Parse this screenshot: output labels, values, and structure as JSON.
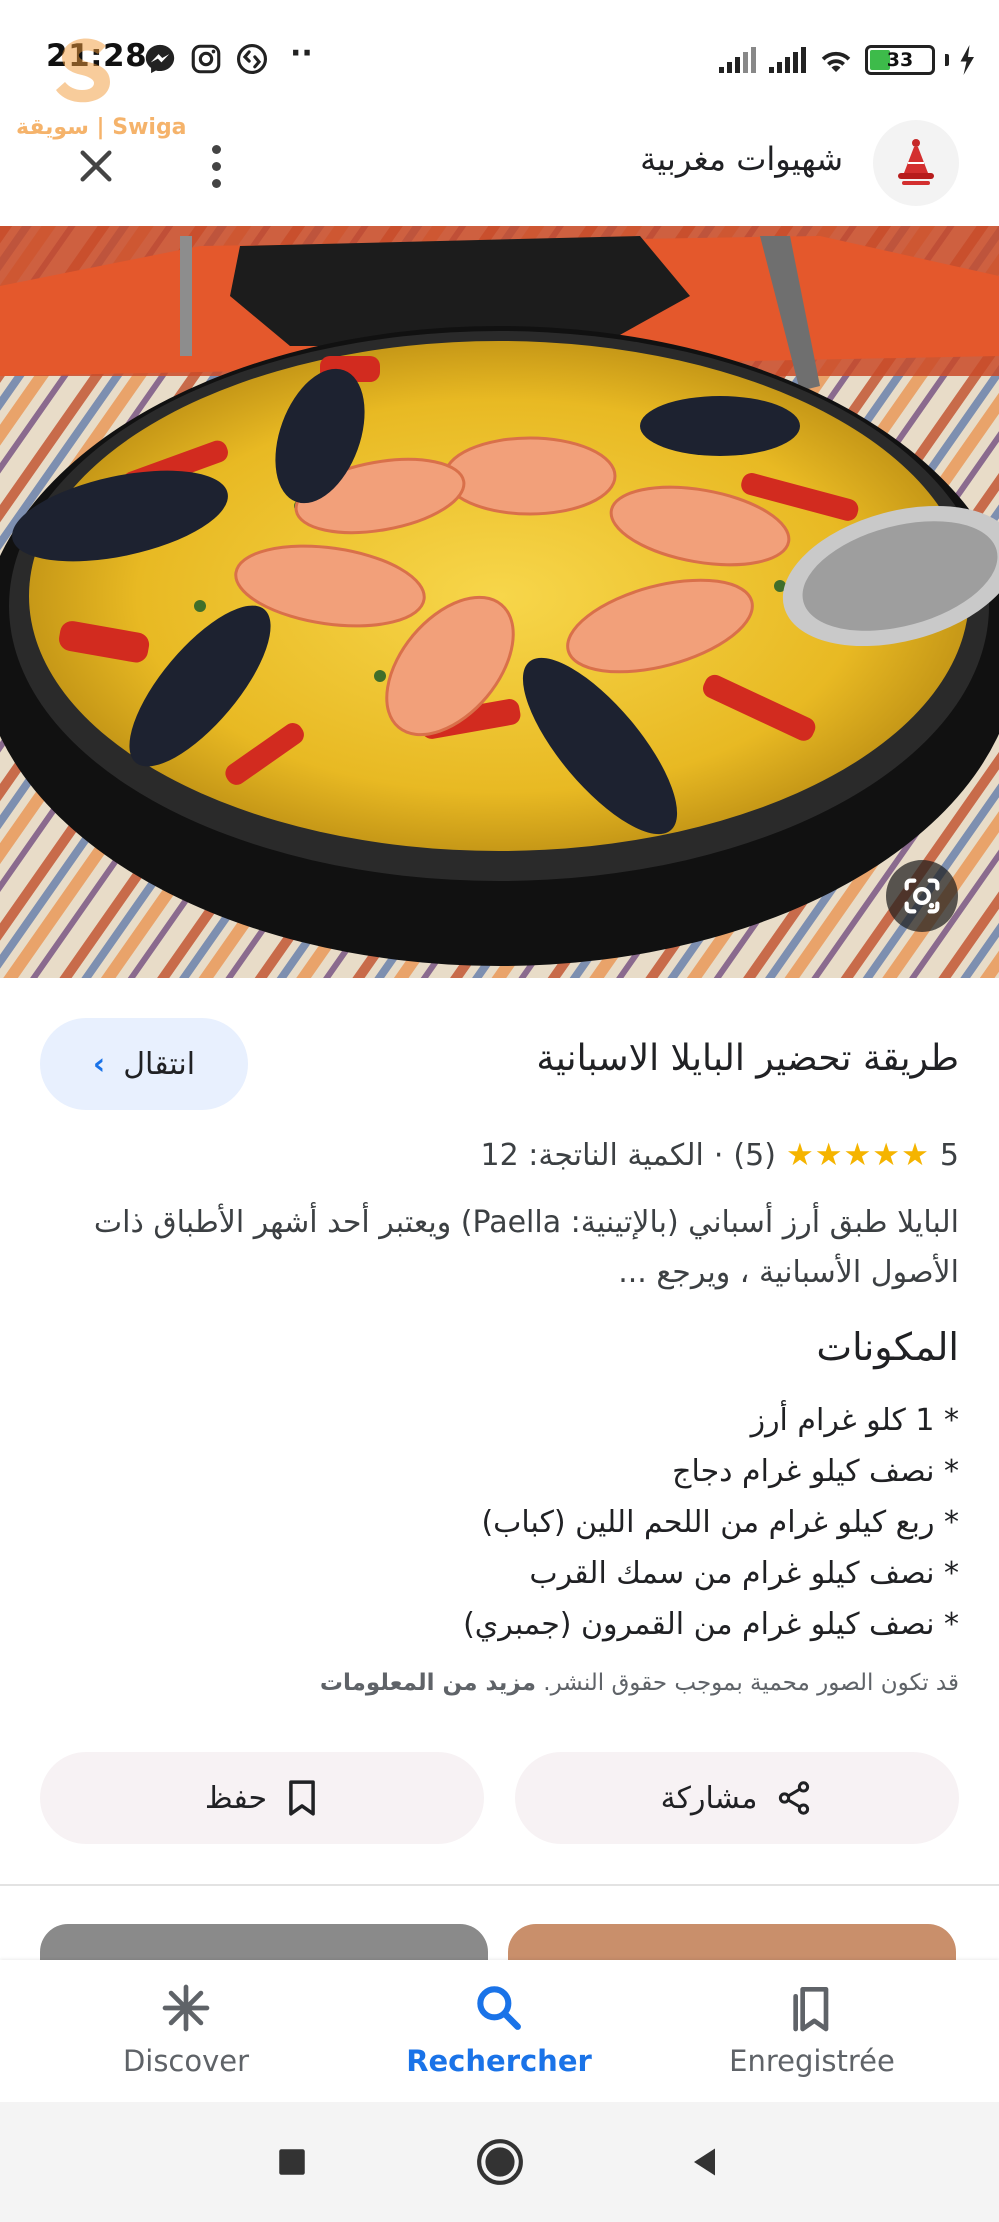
{
  "status_bar": {
    "time": "21:28",
    "battery": "33",
    "battery_level": 0.33,
    "icons": [
      "messenger-icon",
      "instagram-icon",
      "shazam-icon",
      "signal-icon",
      "signal-icon",
      "wifi-icon",
      "battery-icon",
      "charging-icon"
    ]
  },
  "watermark": {
    "text": "سويقة | Swiga"
  },
  "header": {
    "site_name": "شهيوات مغربية",
    "close_icon": "close-icon",
    "more_icon": "more-vert-icon"
  },
  "recipe": {
    "title": "طريقة تحضير البايلا الاسبانية",
    "visit_label": "انتقال",
    "rating_value": "5",
    "stars": "★★★★★",
    "rating_count": "(5)",
    "separator": "·",
    "yield": "الكمية الناتجة: 12",
    "description": "البايلا طبق أرز أسباني (بالإتينية: Paella) ويعتبر أحد أشهر الأطباق ذات الأصول الأسبانية ، ويرجع ...",
    "ingredients_title": "المكونات",
    "ingredients": [
      "* 1 كلو غرام أرز",
      "* نصف كيلو غرام دجاج",
      "* ربع كيلو غرام من اللحم اللين (كباب)",
      "* نصف كيلو غرام من سمك القرب",
      "* نصف كيلو غرام من القمرون (جمبري)"
    ],
    "copyright_notice": "قد تكون الصور محمية بموجب حقوق النشر.",
    "more_info_link": "مزيد من المعلومات",
    "share_label": "مشاركة",
    "save_label": "حفظ"
  },
  "bottom_nav": {
    "items": [
      {
        "label": "Discover",
        "icon": "discover-icon",
        "active": false
      },
      {
        "label": "Rechercher",
        "icon": "search-icon",
        "active": true
      },
      {
        "label": "Enregistrée",
        "icon": "saved-icon",
        "active": false
      }
    ]
  },
  "colors": {
    "accent": "#1a73e8",
    "star": "#f5b400",
    "visit_bg": "#e8f0fe",
    "action_bg": "#f7f2f4"
  }
}
